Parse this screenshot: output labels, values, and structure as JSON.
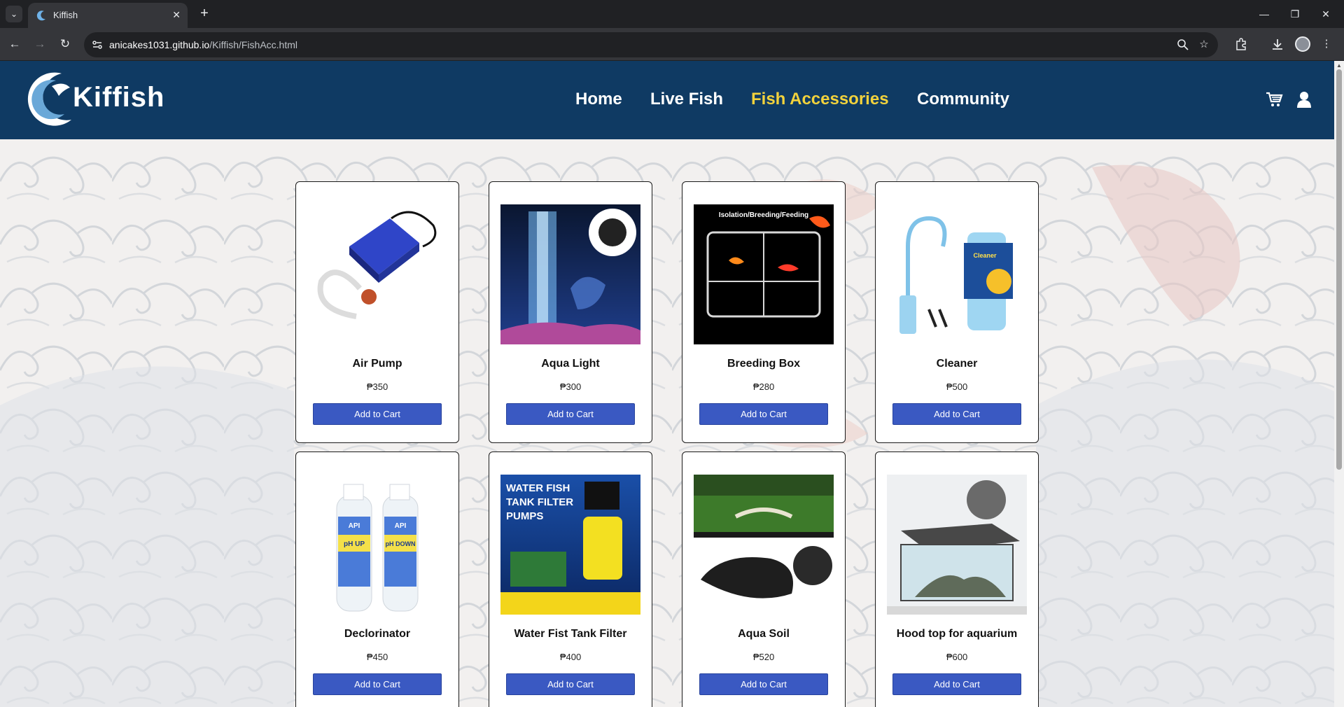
{
  "browser": {
    "tab_title": "Kiffish",
    "tab_close": "✕",
    "new_tab": "+",
    "url_host": "anicakes1031.github.io",
    "url_path": "/Kiffish/FishAcc.html"
  },
  "header": {
    "logo_text": "Kiffish",
    "nav": [
      "Home",
      "Live Fish",
      "Fish Accessories",
      "Community"
    ],
    "active_nav": "Fish Accessories",
    "accent_color": "#f2d23c",
    "header_color": "#0f3a63"
  },
  "products": [
    {
      "name": "Air Pump",
      "price": "₱350",
      "button": "Add to Cart",
      "image": "air-pump-image"
    },
    {
      "name": "Aqua Light",
      "price": "₱300",
      "button": "Add to Cart",
      "image": "aqua-light-image"
    },
    {
      "name": "Breeding Box",
      "price": "₱280",
      "button": "Add to Cart",
      "image": "breeding-box-image",
      "image_caption": "Isolation/Breeding/Feeding"
    },
    {
      "name": "Cleaner",
      "price": "₱500",
      "button": "Add to Cart",
      "image": "cleaner-image",
      "image_caption": "Cleaner"
    },
    {
      "name": "Declorinator",
      "price": "₱450",
      "button": "Add to Cart",
      "image": "declorinator-image",
      "image_caption": [
        "API",
        "pH UP",
        "pH DOWN"
      ]
    },
    {
      "name": "Water Fist Tank Filter",
      "price": "₱400",
      "button": "Add to Cart",
      "image": "tank-filter-image",
      "image_caption": [
        "WATER FISH",
        "TANK FILTER",
        "PUMPS"
      ]
    },
    {
      "name": "Aqua Soil",
      "price": "₱520",
      "button": "Add to Cart",
      "image": "aqua-soil-image"
    },
    {
      "name": "Hood top for aquarium",
      "price": "₱600",
      "button": "Add to Cart",
      "image": "hood-top-image"
    }
  ],
  "button_color": "#3a59c2"
}
